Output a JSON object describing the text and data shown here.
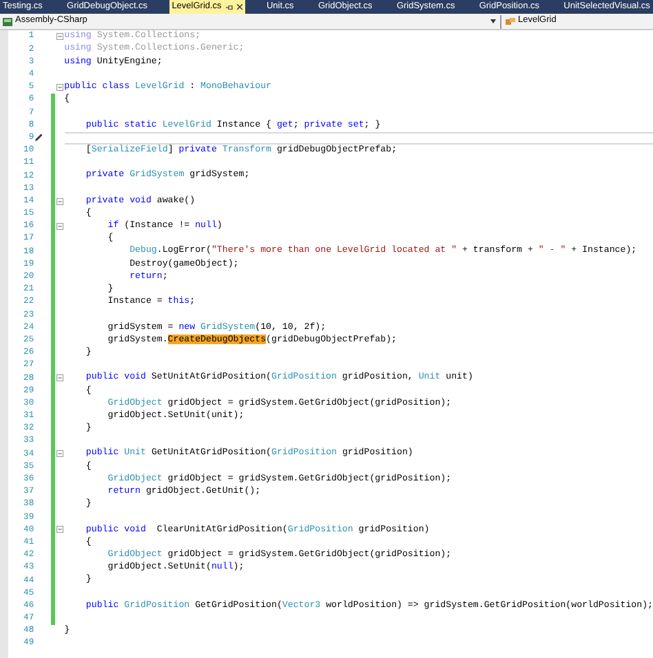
{
  "tabs": [
    {
      "label": "Testing.cs",
      "selected": false
    },
    {
      "label": "GridDebugObject.cs",
      "selected": false
    },
    {
      "label": "LevelGrid.cs",
      "selected": true
    },
    {
      "label": "Unit.cs",
      "selected": false
    },
    {
      "label": "GridObject.cs",
      "selected": false
    },
    {
      "label": "GridSystem.cs",
      "selected": false
    },
    {
      "label": "GridPosition.cs",
      "selected": false
    },
    {
      "label": "UnitSelectedVisual.cs",
      "selected": false
    }
  ],
  "navigation_bar": {
    "project": "Assembly-CSharp",
    "member": "LevelGrid"
  },
  "lines": [
    {
      "number": "1",
      "changed": false,
      "foldable": true,
      "current": false,
      "tokens": [
        {
          "kind": "dimkw",
          "text": "using"
        },
        {
          "kind": "dim",
          "text": " System.Collections;"
        }
      ]
    },
    {
      "number": "2",
      "changed": false,
      "foldable": false,
      "current": false,
      "tokens": [
        {
          "kind": "dimkw",
          "text": "using"
        },
        {
          "kind": "dim",
          "text": " System.Collections.Generic;"
        }
      ]
    },
    {
      "number": "3",
      "changed": false,
      "foldable": false,
      "current": false,
      "tokens": [
        {
          "kind": "kw",
          "text": "using"
        },
        {
          "kind": "plain",
          "text": " UnityEngine;"
        }
      ]
    },
    {
      "number": "4",
      "changed": false,
      "foldable": false,
      "current": false
    },
    {
      "number": "5",
      "changed": false,
      "foldable": true,
      "current": false,
      "tokens": [
        {
          "kind": "kw",
          "text": "public class"
        },
        {
          "kind": "type",
          "text": " LevelGrid"
        },
        {
          "kind": "plain",
          "text": " : "
        },
        {
          "kind": "type",
          "text": "MonoBehaviour"
        }
      ]
    },
    {
      "number": "6",
      "changed": true,
      "foldable": false,
      "current": false,
      "tokens": [
        {
          "kind": "plain",
          "text": "{"
        }
      ]
    },
    {
      "number": "7",
      "changed": true,
      "foldable": false,
      "current": false
    },
    {
      "number": "8",
      "changed": true,
      "foldable": false,
      "current": false,
      "tokens": [
        {
          "kind": "kw",
          "text": "    public static"
        },
        {
          "kind": "type",
          "text": " LevelGrid"
        },
        {
          "kind": "plain",
          "text": " Instance { "
        },
        {
          "kind": "kw",
          "text": "get"
        },
        {
          "kind": "plain",
          "text": "; "
        },
        {
          "kind": "kw",
          "text": "private set"
        },
        {
          "kind": "plain",
          "text": "; }"
        }
      ]
    },
    {
      "number": "9",
      "changed": true,
      "foldable": false,
      "current": true
    },
    {
      "number": "10",
      "changed": true,
      "foldable": false,
      "current": false,
      "tokens": [
        {
          "kind": "plain",
          "text": "    ["
        },
        {
          "kind": "type",
          "text": "SerializeField"
        },
        {
          "kind": "plain",
          "text": "] "
        },
        {
          "kind": "kw",
          "text": "private"
        },
        {
          "kind": "type",
          "text": " Transform"
        },
        {
          "kind": "plain",
          "text": " gridDebugObjectPrefab;"
        }
      ]
    },
    {
      "number": "11",
      "changed": true,
      "foldable": false,
      "current": false
    },
    {
      "number": "12",
      "changed": true,
      "foldable": false,
      "current": false,
      "tokens": [
        {
          "kind": "kw",
          "text": "    private"
        },
        {
          "kind": "type",
          "text": " GridSystem"
        },
        {
          "kind": "plain",
          "text": " gridSystem;"
        }
      ]
    },
    {
      "number": "13",
      "changed": true,
      "foldable": false,
      "current": false
    },
    {
      "number": "14",
      "changed": true,
      "foldable": true,
      "current": false,
      "tokens": [
        {
          "kind": "kw",
          "text": "    private void"
        },
        {
          "kind": "plain",
          "text": " awake()"
        }
      ]
    },
    {
      "number": "15",
      "changed": true,
      "foldable": false,
      "current": false,
      "tokens": [
        {
          "kind": "plain",
          "text": "    {"
        }
      ]
    },
    {
      "number": "16",
      "changed": true,
      "foldable": true,
      "current": false,
      "tokens": [
        {
          "kind": "kw",
          "text": "        if"
        },
        {
          "kind": "plain",
          "text": " (Instance != "
        },
        {
          "kind": "kw",
          "text": "null"
        },
        {
          "kind": "plain",
          "text": ")"
        }
      ]
    },
    {
      "number": "17",
      "changed": true,
      "foldable": false,
      "current": false,
      "tokens": [
        {
          "kind": "plain",
          "text": "        {"
        }
      ]
    },
    {
      "number": "18",
      "changed": true,
      "foldable": false,
      "current": false,
      "tokens": [
        {
          "kind": "type",
          "text": "            Debug"
        },
        {
          "kind": "plain",
          "text": ".LogError("
        },
        {
          "kind": "str",
          "text": "\"There's more than one LevelGrid located at \""
        },
        {
          "kind": "plain",
          "text": " + transform + "
        },
        {
          "kind": "str",
          "text": "\" - \""
        },
        {
          "kind": "plain",
          "text": " + Instance);"
        }
      ]
    },
    {
      "number": "19",
      "changed": true,
      "foldable": false,
      "current": false,
      "tokens": [
        {
          "kind": "plain",
          "text": "            Destroy(gameObject);"
        }
      ]
    },
    {
      "number": "20",
      "changed": true,
      "foldable": false,
      "current": false,
      "tokens": [
        {
          "kind": "kw",
          "text": "            return"
        },
        {
          "kind": "plain",
          "text": ";"
        }
      ]
    },
    {
      "number": "21",
      "changed": true,
      "foldable": false,
      "current": false,
      "tokens": [
        {
          "kind": "plain",
          "text": "        }"
        }
      ]
    },
    {
      "number": "22",
      "changed": true,
      "foldable": false,
      "current": false,
      "tokens": [
        {
          "kind": "plain",
          "text": "        Instance = "
        },
        {
          "kind": "kw",
          "text": "this"
        },
        {
          "kind": "plain",
          "text": ";"
        }
      ]
    },
    {
      "number": "23",
      "changed": true,
      "foldable": false,
      "current": false
    },
    {
      "number": "24",
      "changed": true,
      "foldable": false,
      "current": false,
      "tokens": [
        {
          "kind": "plain",
          "text": "        gridSystem = "
        },
        {
          "kind": "kw",
          "text": "new"
        },
        {
          "kind": "type",
          "text": " GridSystem"
        },
        {
          "kind": "plain",
          "text": "(10, 10, 2f);"
        }
      ]
    },
    {
      "number": "25",
      "changed": true,
      "foldable": false,
      "current": false,
      "tokens": [
        {
          "kind": "plain",
          "text": "        gridSystem."
        },
        {
          "kind": "highlight",
          "text": "CreateDebugObjects"
        },
        {
          "kind": "plain",
          "text": "(gridDebugObjectPrefab);"
        }
      ]
    },
    {
      "number": "26",
      "changed": true,
      "foldable": false,
      "current": false,
      "tokens": [
        {
          "kind": "plain",
          "text": "    }"
        }
      ]
    },
    {
      "number": "27",
      "changed": true,
      "foldable": false,
      "current": false
    },
    {
      "number": "28",
      "changed": true,
      "foldable": true,
      "current": false,
      "tokens": [
        {
          "kind": "kw",
          "text": "    public void"
        },
        {
          "kind": "plain",
          "text": " SetUnitAtGridPosition("
        },
        {
          "kind": "type",
          "text": "GridPosition"
        },
        {
          "kind": "plain",
          "text": " gridPosition, "
        },
        {
          "kind": "type",
          "text": "Unit"
        },
        {
          "kind": "plain",
          "text": " unit)"
        }
      ]
    },
    {
      "number": "29",
      "changed": true,
      "foldable": false,
      "current": false,
      "tokens": [
        {
          "kind": "plain",
          "text": "    {"
        }
      ]
    },
    {
      "number": "30",
      "changed": true,
      "foldable": false,
      "current": false,
      "tokens": [
        {
          "kind": "type",
          "text": "        GridObject"
        },
        {
          "kind": "plain",
          "text": " gridObject = gridSystem.GetGridObject(gridPosition);"
        }
      ]
    },
    {
      "number": "31",
      "changed": true,
      "foldable": false,
      "current": false,
      "tokens": [
        {
          "kind": "plain",
          "text": "        gridObject.SetUnit(unit);"
        }
      ]
    },
    {
      "number": "32",
      "changed": true,
      "foldable": false,
      "current": false,
      "tokens": [
        {
          "kind": "plain",
          "text": "    }"
        }
      ]
    },
    {
      "number": "33",
      "changed": true,
      "foldable": false,
      "current": false
    },
    {
      "number": "34",
      "changed": true,
      "foldable": true,
      "current": false,
      "tokens": [
        {
          "kind": "kw",
          "text": "    public"
        },
        {
          "kind": "type",
          "text": " Unit"
        },
        {
          "kind": "plain",
          "text": " GetUnitAtGridPosition("
        },
        {
          "kind": "type",
          "text": "GridPosition"
        },
        {
          "kind": "plain",
          "text": " gridPosition)"
        }
      ]
    },
    {
      "number": "35",
      "changed": true,
      "foldable": false,
      "current": false,
      "tokens": [
        {
          "kind": "plain",
          "text": "    {"
        }
      ]
    },
    {
      "number": "36",
      "changed": true,
      "foldable": false,
      "current": false,
      "tokens": [
        {
          "kind": "type",
          "text": "        GridObject"
        },
        {
          "kind": "plain",
          "text": " gridObject = gridSystem.GetGridObject(gridPosition);"
        }
      ]
    },
    {
      "number": "37",
      "changed": true,
      "foldable": false,
      "current": false,
      "tokens": [
        {
          "kind": "kw",
          "text": "        return"
        },
        {
          "kind": "plain",
          "text": " gridObject.GetUnit();"
        }
      ]
    },
    {
      "number": "38",
      "changed": true,
      "foldable": false,
      "current": false,
      "tokens": [
        {
          "kind": "plain",
          "text": "    }"
        }
      ]
    },
    {
      "number": "39",
      "changed": true,
      "foldable": false,
      "current": false
    },
    {
      "number": "40",
      "changed": true,
      "foldable": true,
      "current": false,
      "tokens": [
        {
          "kind": "kw",
          "text": "    public void"
        },
        {
          "kind": "plain",
          "text": "  ClearUnitAtGridPosition("
        },
        {
          "kind": "type",
          "text": "GridPosition"
        },
        {
          "kind": "plain",
          "text": " gridPosition)"
        }
      ]
    },
    {
      "number": "41",
      "changed": true,
      "foldable": false,
      "current": false,
      "tokens": [
        {
          "kind": "plain",
          "text": "    {"
        }
      ]
    },
    {
      "number": "42",
      "changed": true,
      "foldable": false,
      "current": false,
      "tokens": [
        {
          "kind": "type",
          "text": "        GridObject"
        },
        {
          "kind": "plain",
          "text": " gridObject = gridSystem.GetGridObject(gridPosition);"
        }
      ]
    },
    {
      "number": "43",
      "changed": true,
      "foldable": false,
      "current": false,
      "tokens": [
        {
          "kind": "plain",
          "text": "        gridObject.SetUnit("
        },
        {
          "kind": "kw",
          "text": "null"
        },
        {
          "kind": "plain",
          "text": ");"
        }
      ]
    },
    {
      "number": "44",
      "changed": true,
      "foldable": false,
      "current": false,
      "tokens": [
        {
          "kind": "plain",
          "text": "    }"
        }
      ]
    },
    {
      "number": "45",
      "changed": true,
      "foldable": false,
      "current": false
    },
    {
      "number": "46",
      "changed": true,
      "foldable": false,
      "current": false,
      "tokens": [
        {
          "kind": "kw",
          "text": "    public"
        },
        {
          "kind": "type",
          "text": " GridPosition"
        },
        {
          "kind": "plain",
          "text": " GetGridPosition("
        },
        {
          "kind": "type",
          "text": "Vector3"
        },
        {
          "kind": "plain",
          "text": " worldPosition) => gridSystem.GetGridPosition(worldPosition);"
        }
      ]
    },
    {
      "number": "47",
      "changed": true,
      "foldable": false,
      "current": false
    },
    {
      "number": "48",
      "changed": false,
      "foldable": false,
      "current": false,
      "tokens": [
        {
          "kind": "plain",
          "text": "}"
        }
      ]
    },
    {
      "number": "49",
      "changed": false,
      "foldable": false,
      "current": false
    }
  ]
}
